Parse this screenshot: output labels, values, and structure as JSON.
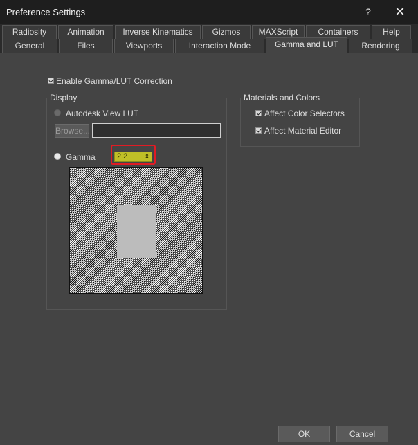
{
  "window": {
    "title": "Preference Settings",
    "help_glyph": "?",
    "close_glyph": "✕"
  },
  "tabs_row1": [
    "Radiosity",
    "Animation",
    "Inverse Kinematics",
    "Gizmos",
    "MAXScript",
    "Containers",
    "Help"
  ],
  "tabs_row2": [
    "General",
    "Files",
    "Viewports",
    "Interaction Mode",
    "Gamma and LUT",
    "Rendering"
  ],
  "active_tab": "Gamma and LUT",
  "enable": {
    "label": "Enable Gamma/LUT Correction",
    "checked": true
  },
  "display": {
    "title": "Display",
    "lut": {
      "label": "Autodesk View LUT",
      "selected": false
    },
    "browse_label": "Browse...",
    "path_value": "",
    "gamma": {
      "label": "Gamma",
      "selected": true,
      "value": "2.2",
      "arrows": "⇕"
    }
  },
  "materials": {
    "title": "Materials and Colors",
    "affect_selectors": {
      "label": "Affect Color Selectors",
      "checked": true
    },
    "affect_editor": {
      "label": "Affect Material Editor",
      "checked": true
    }
  },
  "buttons": {
    "ok": "OK",
    "cancel": "Cancel"
  },
  "colors": {
    "titlebar": "#1e1e1e",
    "panel": "#444444",
    "gamma_spinner": "#bfbf27",
    "highlight": "#e01b24"
  },
  "icons": {
    "help": "help-icon",
    "close": "close-icon",
    "spinner": "spinner-arrows-icon"
  }
}
